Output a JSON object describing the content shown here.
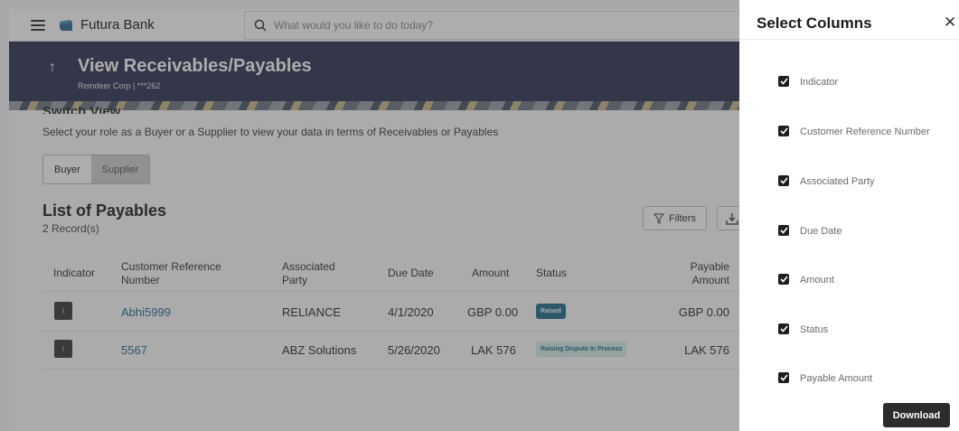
{
  "header": {
    "brand": "Futura Bank",
    "search_placeholder": "What would you like to do today?"
  },
  "hero": {
    "title": "View Receivables/Payables",
    "subtitle": "Reindeer Corp | ***262"
  },
  "switch_view": {
    "title": "Switch View",
    "description": "Select your role as a Buyer or a Supplier to view your data in terms of Receivables or Payables",
    "buyer_label": "Buyer",
    "supplier_label": "Supplier"
  },
  "list": {
    "title": "List of Payables",
    "count": "2 Record(s)",
    "filters_label": "Filters",
    "columns": {
      "indicator": "Indicator",
      "customer_ref_line1": "Customer Reference",
      "customer_ref_line2": "Number",
      "party_line1": "Associated",
      "party_line2": "Party",
      "due_date": "Due Date",
      "amount": "Amount",
      "status": "Status",
      "payable_line1": "Payable",
      "payable_line2": "Amount"
    },
    "rows": [
      {
        "indicator": "I",
        "ref": "Abhi5999",
        "party": "RELIANCE",
        "due_date": "4/1/2020",
        "amount": "GBP 0.00",
        "status": "Raised",
        "payable": "GBP 0.00"
      },
      {
        "indicator": "I",
        "ref": "5567",
        "party": "ABZ Solutions",
        "due_date": "5/26/2020",
        "amount": "LAK 576",
        "status": "Raising Dispute In Process",
        "payable": "LAK 576"
      }
    ]
  },
  "panel": {
    "title": "Select Columns",
    "close_icon": "close-icon",
    "columns": [
      {
        "label": "Indicator",
        "checked": true
      },
      {
        "label": "Customer Reference Number",
        "checked": true
      },
      {
        "label": "Associated Party",
        "checked": true
      },
      {
        "label": "Due Date",
        "checked": true
      },
      {
        "label": "Amount",
        "checked": true
      },
      {
        "label": "Status",
        "checked": true
      },
      {
        "label": "Payable Amount",
        "checked": true
      }
    ],
    "download_label": "Download"
  },
  "colors": {
    "hero_bg": "#2f3553",
    "link": "#236b93",
    "badge_raised": "#1f6f8a",
    "badge_dispute_bg": "#d4ecec"
  }
}
